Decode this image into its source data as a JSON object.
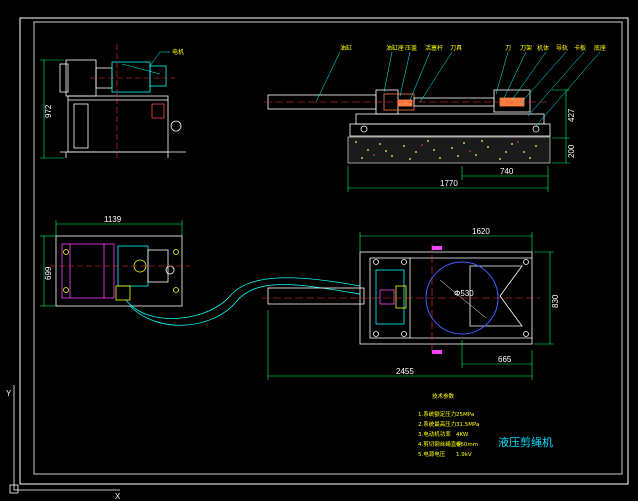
{
  "title": "液压剪绳机",
  "dimensions": {
    "front_height": "972",
    "side_length_total": "1770",
    "side_length_right": "740",
    "side_height_upper": "427",
    "side_height_lower": "200",
    "plan_pump_width": "1139",
    "plan_pump_depth": "699",
    "plan_top_width": "1620",
    "plan_depth": "830",
    "plan_total": "2455",
    "plan_right": "665",
    "plan_diameter": "Φ530"
  },
  "labels": {
    "motor": "电机",
    "tube": "油缸",
    "parts": [
      "油缸座",
      "压盖",
      "活塞杆",
      "刀具",
      "刀",
      "刀架",
      "机体",
      "导轨",
      "卡板",
      "底座"
    ]
  },
  "specs": {
    "heading": "技术参数",
    "lines": [
      {
        "name": "1.系统额定压力",
        "value": "25MPa"
      },
      {
        "name": "2.系统最高压力",
        "value": "31.5MPa"
      },
      {
        "name": "3.电动机功率",
        "value": "4KW"
      },
      {
        "name": "4.剪切钢丝绳直径",
        "value": "Φ60mm"
      },
      {
        "name": "5.电源电压",
        "value": "1.9kV"
      }
    ]
  }
}
